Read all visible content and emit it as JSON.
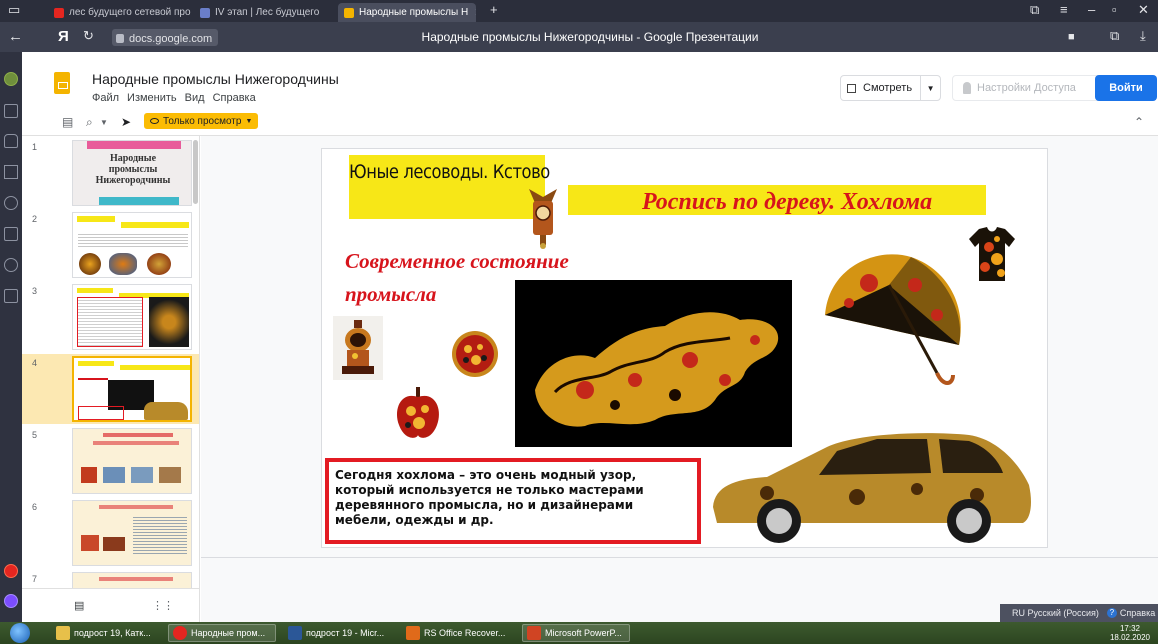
{
  "browser": {
    "tabs": [
      {
        "label": "лес будущего сетевой про",
        "icon": "yandex-icon"
      },
      {
        "label": "IV этап | Лес будущего",
        "icon": "wix-icon"
      },
      {
        "label": "Народные промыслы Н",
        "icon": "slides-icon",
        "active": true
      }
    ],
    "new_tab": "+",
    "url": "docs.google.com",
    "page_title": "Народные промыслы Нижегородчины - Google Презентации",
    "yandex_logo": "Я"
  },
  "docs": {
    "title": "Народные промыслы Нижегородчины",
    "menus": [
      "Файл",
      "Изменить",
      "Вид",
      "Справка"
    ],
    "view_button": "Смотреть",
    "access_button": "Настройки Доступа",
    "login_button": "Войти"
  },
  "toolbar": {
    "view_only_label": "Только просмотр"
  },
  "filmstrip": {
    "slides": [
      {
        "number": "1",
        "thumb_title": "Народные промыслы Нижегородчины"
      },
      {
        "number": "2"
      },
      {
        "number": "3"
      },
      {
        "number": "4"
      },
      {
        "number": "5"
      },
      {
        "number": "6"
      },
      {
        "number": "7"
      }
    ]
  },
  "slide": {
    "title": "Юные лесоводы. Кстово",
    "subtitle": "Роспись по дереву. Хохлома",
    "state_heading": "Современное состояние промысла",
    "body_text": "Сегодня хохлома – это очень модный узор, который используется не только мастерами деревянного промысла, но и дизайнерами мебели, одежды и др."
  },
  "status": {
    "language": "RU Русский (Россия)",
    "help": "Справка"
  },
  "taskbar": {
    "items": [
      {
        "label": "подрост 19, Катк...",
        "icon": "folder-icon"
      },
      {
        "label": "Народные пром...",
        "icon": "yandex-browser-icon"
      },
      {
        "label": "подрост 19 - Micr...",
        "icon": "word-icon"
      },
      {
        "label": "RS Office Recover...",
        "icon": "rs-icon"
      },
      {
        "label": "Microsoft PowerP...",
        "icon": "powerpoint-icon"
      }
    ],
    "time": "17:32",
    "date": "18.02.2020"
  },
  "colors": {
    "accent_yellow": "#f7e717",
    "heading_red": "#d7141c",
    "frame_red": "#e31b23",
    "login_blue": "#1a73e8",
    "view_only_amber": "#fbbc04"
  }
}
